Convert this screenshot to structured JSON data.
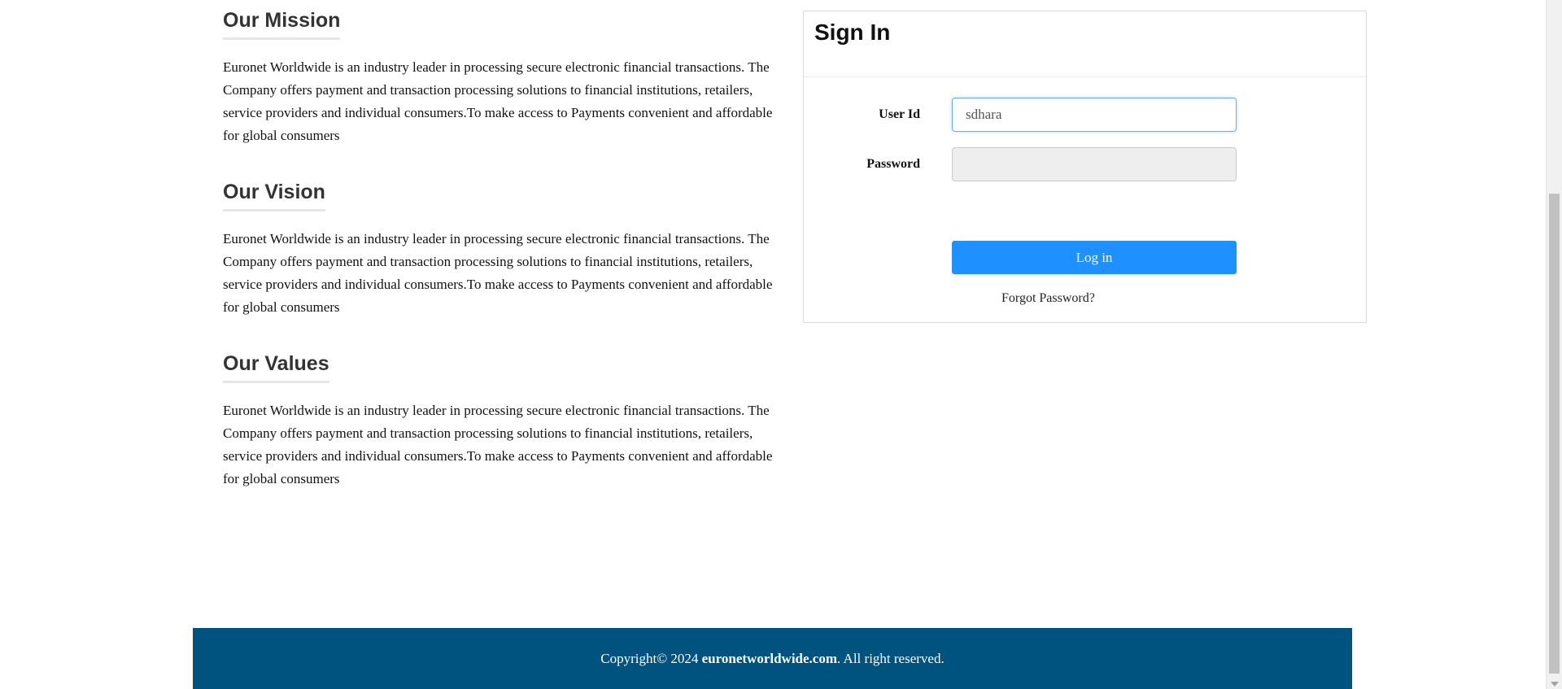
{
  "sections": [
    {
      "title": "Our Mission",
      "body": "Euronet Worldwide is an industry leader in processing secure electronic financial transactions. The Company offers payment and transaction processing solutions to financial institutions, retailers, service providers and individual consumers.To make access to Payments convenient and affordable for global consumers"
    },
    {
      "title": "Our Vision",
      "body": "Euronet Worldwide is an industry leader in processing secure electronic financial transactions. The Company offers payment and transaction processing solutions to financial institutions, retailers, service providers and individual consumers.To make access to Payments convenient and affordable for global consumers"
    },
    {
      "title": "Our Values",
      "body": "Euronet Worldwide is an industry leader in processing secure electronic financial transactions. The Company offers payment and transaction processing solutions to financial institutions, retailers, service providers and individual consumers.To make access to Payments convenient and affordable for global consumers"
    }
  ],
  "signin": {
    "title": "Sign In",
    "userid_label": "User Id",
    "userid_value": "sdhara",
    "password_label": "Password",
    "password_value": "",
    "login_label": "Log in",
    "forgot_label": "Forgot Password?"
  },
  "footer": {
    "prefix": "Copyright© 2024 ",
    "site": "euronetworldwide.com",
    "suffix": ". All right reserved."
  },
  "colors": {
    "primary_button": "#1e90ff",
    "footer_bg": "#00527f",
    "focus_border": "#66afe9"
  }
}
